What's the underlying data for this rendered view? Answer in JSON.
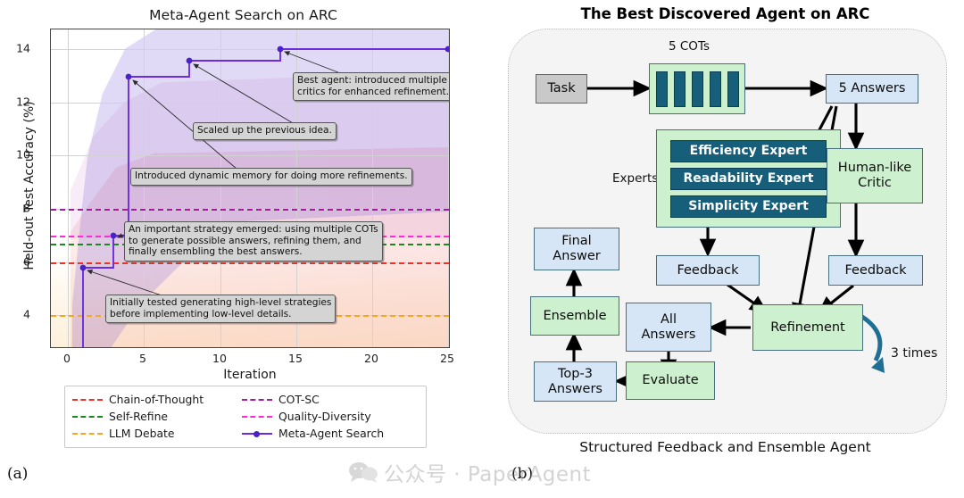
{
  "panel_a": {
    "figure_label": "(a)",
    "chart_data": {
      "type": "line",
      "title": "Meta-Agent Search on ARC",
      "xlabel": "Iteration",
      "ylabel": "Held-out Test Accuracy (%)",
      "xlim": [
        -1.2,
        26.5
      ],
      "ylim": [
        2.9,
        14.9
      ],
      "xticks": [
        0,
        5,
        10,
        15,
        20,
        25
      ],
      "yticks": [
        4,
        6,
        8,
        10,
        12,
        14
      ],
      "grid": true,
      "legend_position": "below-axes",
      "baselines": [
        {
          "name": "Chain-of-Thought",
          "value": 6.0,
          "color": "#e8322a",
          "style": "dashed"
        },
        {
          "name": "Self-Refine",
          "value": 6.7,
          "color": "#1a8a1f",
          "style": "dashed"
        },
        {
          "name": "LLM Debate",
          "value": 4.0,
          "color": "#f5a623",
          "style": "dashed"
        },
        {
          "name": "COT-SC",
          "value": 8.0,
          "color": "#a01ea0",
          "style": "dashed"
        },
        {
          "name": "Quality-Diversity",
          "value": 7.0,
          "color": "#ff2ad4",
          "style": "dashed"
        }
      ],
      "series": [
        {
          "name": "Meta-Agent Search",
          "color": "#6a2ddd",
          "style": "step-post",
          "marker": "circle",
          "x": [
            1,
            3,
            4,
            8,
            14,
            25
          ],
          "y": [
            6.3,
            7.75,
            11.7,
            12.7,
            13.7,
            13.7
          ]
        }
      ],
      "confidence_bands": [
        {
          "name": "Meta-Agent Search CI",
          "color": "#7f5bd8",
          "opacity": 0.2
        },
        {
          "name": "COT-SC CI",
          "color": "#a01ea0",
          "opacity": 0.1
        },
        {
          "name": "Chain-of-Thought CI",
          "color": "#e8322a",
          "opacity": 0.1
        },
        {
          "name": "LLM Debate CI",
          "color": "#f5a623",
          "opacity": 0.1
        }
      ],
      "annotations": [
        {
          "id": "anno-best-agent",
          "text": "Best agent: introduced multiple\ncritics for enhanced refinement.",
          "points_to_x": 14,
          "points_to_y": 13.7
        },
        {
          "id": "anno-scaled-up",
          "text": "Scaled up the previous idea.",
          "points_to_x": 8,
          "points_to_y": 12.7
        },
        {
          "id": "anno-dynamic-memory",
          "text": "Introduced dynamic memory for doing more refinements.",
          "points_to_x": 4,
          "points_to_y": 11.7
        },
        {
          "id": "anno-important-strategy",
          "text": "An important strategy emerged: using multiple COTs\nto generate possible answers, refining them, and\nfinally ensembling the best answers.",
          "points_to_x": 3,
          "points_to_y": 7.75
        },
        {
          "id": "anno-initial",
          "text": "Initially tested generating high-level strategies\nbefore implementing low-level details.",
          "points_to_x": 1,
          "points_to_y": 6.3
        }
      ],
      "legend_entries": [
        {
          "label": "Chain-of-Thought",
          "color": "#e8322a",
          "style": "dashed"
        },
        {
          "label": "COT-SC",
          "color": "#a01ea0",
          "style": "dashed"
        },
        {
          "label": "Self-Refine",
          "color": "#1a8a1f",
          "style": "dashed"
        },
        {
          "label": "Quality-Diversity",
          "color": "#ff2ad4",
          "style": "dashed"
        },
        {
          "label": "LLM Debate",
          "color": "#f5a623",
          "style": "dashed"
        },
        {
          "label": "Meta-Agent Search",
          "color": "#6a2ddd",
          "style": "solid-marker"
        }
      ]
    }
  },
  "panel_b": {
    "figure_label": "(b)",
    "title": "The Best Discovered Agent on ARC",
    "caption": "Structured Feedback and Ensemble Agent",
    "labels": {
      "cots": "5 COTs",
      "experts": "Experts",
      "loop_count": "3 times"
    },
    "nodes": [
      {
        "id": "task",
        "label": "Task",
        "kind": "gray"
      },
      {
        "id": "cots-box",
        "label": "",
        "kind": "green-container",
        "bars": 5
      },
      {
        "id": "five-answers",
        "label": "5 Answers",
        "kind": "blue"
      },
      {
        "id": "experts-box",
        "label": "",
        "kind": "green-container"
      },
      {
        "id": "efficiency-expert",
        "label": "Efficiency Expert",
        "kind": "dark"
      },
      {
        "id": "readability-expert",
        "label": "Readability Expert",
        "kind": "dark"
      },
      {
        "id": "simplicity-expert",
        "label": "Simplicity Expert",
        "kind": "dark"
      },
      {
        "id": "human-like-critic",
        "label": "Human-like\nCritic",
        "kind": "green"
      },
      {
        "id": "feedback-left",
        "label": "Feedback",
        "kind": "blue"
      },
      {
        "id": "feedback-right",
        "label": "Feedback",
        "kind": "blue"
      },
      {
        "id": "refinement",
        "label": "Refinement",
        "kind": "green"
      },
      {
        "id": "all-answers",
        "label": "All\nAnswers",
        "kind": "blue"
      },
      {
        "id": "evaluate",
        "label": "Evaluate",
        "kind": "green"
      },
      {
        "id": "top3-answers",
        "label": "Top-3\nAnswers",
        "kind": "blue"
      },
      {
        "id": "ensemble",
        "label": "Ensemble",
        "kind": "green"
      },
      {
        "id": "final-answer",
        "label": "Final\nAnswer",
        "kind": "blue"
      }
    ],
    "node_text": {
      "task": "Task",
      "five_answers": "5 Answers",
      "efficiency_expert": "Efficiency Expert",
      "readability_expert": "Readability Expert",
      "simplicity_expert": "Simplicity Expert",
      "human_like_critic_line1": "Human-like",
      "human_like_critic_line2": "Critic",
      "feedback_left": "Feedback",
      "feedback_right": "Feedback",
      "refinement": "Refinement",
      "all_answers_line1": "All",
      "all_answers_line2": "Answers",
      "evaluate": "Evaluate",
      "top3_line1": "Top-3",
      "top3_line2": "Answers",
      "ensemble": "Ensemble",
      "final_line1": "Final",
      "final_line2": "Answer"
    },
    "colors": {
      "blue_fill": "#d6e6f7",
      "green_fill": "#cdf0ce",
      "dark_fill": "#165e79",
      "gray_fill": "#c9c9c9",
      "loop_arrow": "#1f6f94"
    }
  },
  "watermark": {
    "text": "公众号 · PaperAgent"
  }
}
